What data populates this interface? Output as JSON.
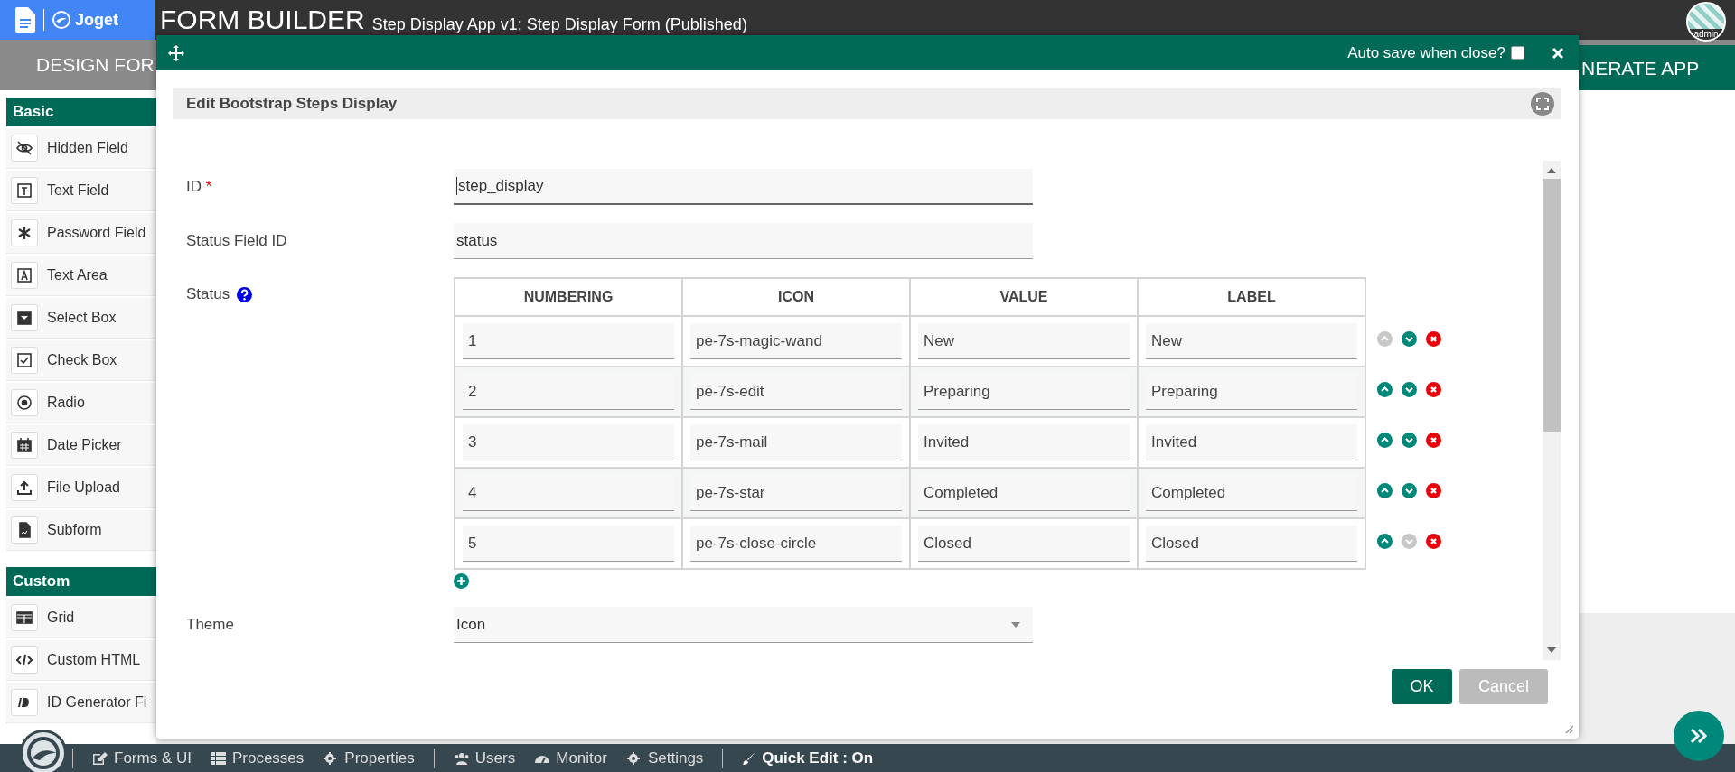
{
  "app_bar": {
    "brand": "Joget",
    "title": "FORM BUILDER",
    "subtitle": "Step Display App v1: Step Display Form (Published)",
    "user": "admin"
  },
  "tab_bar": {
    "left": "DESIGN FOR",
    "right": "NERATE APP"
  },
  "palette": [
    {
      "heading": "Basic",
      "items": [
        "Hidden Field",
        "Text Field",
        "Password Field",
        "Text Area",
        "Select Box",
        "Check Box",
        "Radio",
        "Date Picker",
        "File Upload",
        "Subform"
      ]
    },
    {
      "heading": "Custom",
      "items": [
        "Grid",
        "Custom HTML",
        "ID Generator Fi"
      ]
    }
  ],
  "dialog": {
    "auto_save_label": "Auto save when close?",
    "auto_save_checked": false,
    "heading": "Edit Bootstrap Steps Display",
    "id_field": {
      "label": "ID",
      "required_mark": "*",
      "value": "step_display"
    },
    "status_field": {
      "label": "Status Field ID",
      "value": "status"
    },
    "status_table": {
      "label": "Status",
      "columns": [
        "NUMBERING",
        "ICON",
        "VALUE",
        "LABEL"
      ],
      "rows": [
        {
          "cells": [
            "1",
            "pe-7s-magic-wand",
            "New",
            "New"
          ],
          "up_disabled": true,
          "down_disabled": false
        },
        {
          "cells": [
            "2",
            "pe-7s-edit",
            "Preparing",
            "Preparing"
          ],
          "up_disabled": false,
          "down_disabled": false
        },
        {
          "cells": [
            "3",
            "pe-7s-mail",
            "Invited",
            "Invited"
          ],
          "up_disabled": false,
          "down_disabled": false
        },
        {
          "cells": [
            "4",
            "pe-7s-star",
            "Completed",
            "Completed"
          ],
          "up_disabled": false,
          "down_disabled": false
        },
        {
          "cells": [
            "5",
            "pe-7s-close-circle",
            "Closed",
            "Closed"
          ],
          "up_disabled": false,
          "down_disabled": true
        }
      ]
    },
    "theme_field": {
      "label": "Theme",
      "value": "Icon"
    },
    "buttons": [
      "OK",
      "Cancel"
    ]
  },
  "bottom_bar": {
    "groups": [
      [
        "Forms & UI",
        "Processes",
        "Properties"
      ],
      [
        "Users",
        "Monitor",
        "Settings"
      ]
    ],
    "quick_edit": "Quick Edit : On"
  }
}
